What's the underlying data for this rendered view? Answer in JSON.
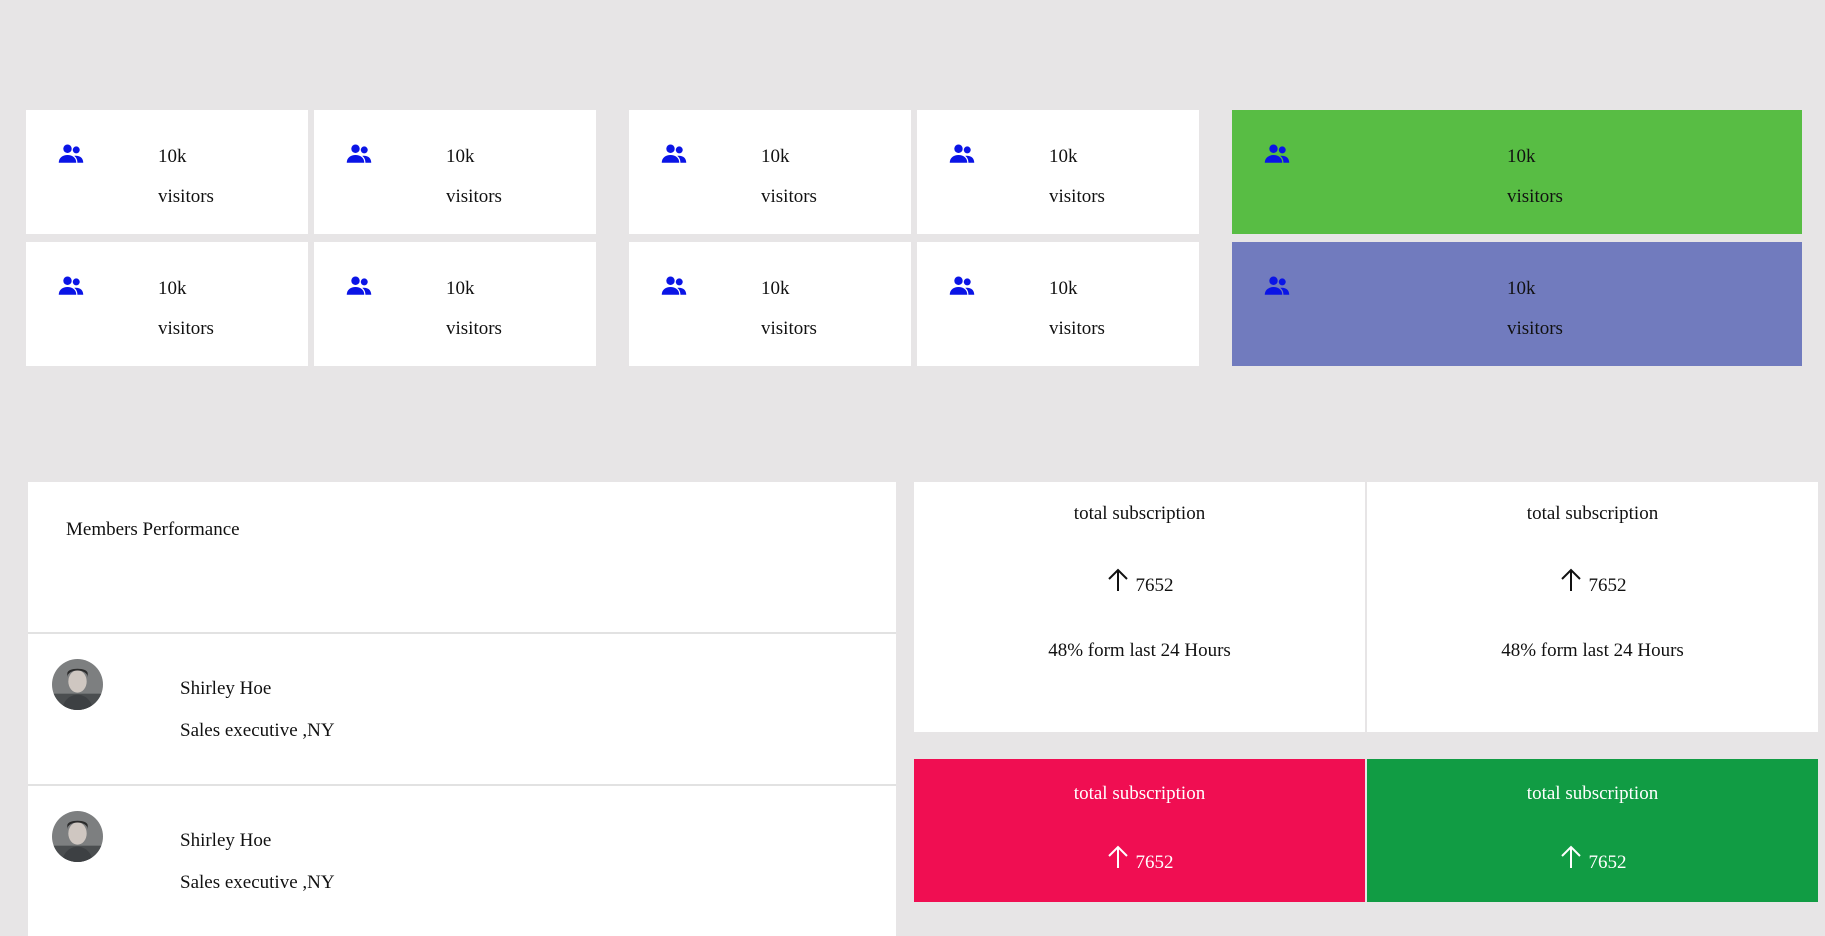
{
  "colors": {
    "background": "#e7e5e6",
    "icon": "#0a14e6",
    "card_green": "#58bd44",
    "card_purple": "#717bbe",
    "card_red": "#f00e52",
    "card_darkgreen": "#119c44"
  },
  "stats": [
    {
      "icon": "users-icon",
      "value": "10k",
      "label": "visitors"
    },
    {
      "icon": "users-icon",
      "value": "10k",
      "label": "visitors"
    },
    {
      "icon": "users-icon",
      "value": "10k",
      "label": "visitors"
    },
    {
      "icon": "users-icon",
      "value": "10k",
      "label": "visitors"
    },
    {
      "icon": "users-icon",
      "value": "10k",
      "label": "visitors"
    },
    {
      "icon": "users-icon",
      "value": "10k",
      "label": "visitors"
    },
    {
      "icon": "users-icon",
      "value": "10k",
      "label": "visitors"
    },
    {
      "icon": "users-icon",
      "value": "10k",
      "label": "visitors"
    },
    {
      "icon": "users-icon",
      "value": "10k",
      "label": "visitors"
    },
    {
      "icon": "users-icon",
      "value": "10k",
      "label": "visitors"
    }
  ],
  "members": {
    "title": "Members Performance",
    "items": [
      {
        "name": "Shirley Hoe",
        "role": "Sales executive ,NY"
      },
      {
        "name": "Shirley Hoe",
        "role": "Sales executive ,NY"
      }
    ]
  },
  "subscriptions": [
    {
      "title": "total subscription",
      "value": "7652",
      "note": "48% form last 24 Hours"
    },
    {
      "title": "total subscription",
      "value": "7652",
      "note": "48% form last 24 Hours"
    },
    {
      "title": "total subscription",
      "value": "7652"
    },
    {
      "title": "total subscription",
      "value": "7652"
    }
  ]
}
